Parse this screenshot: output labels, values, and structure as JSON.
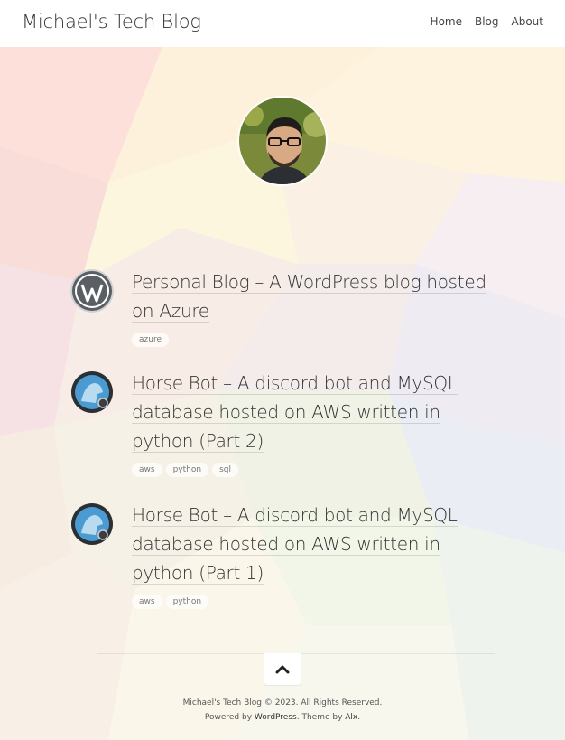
{
  "header": {
    "site_title": "Michael's Tech Blog",
    "nav": [
      "Home",
      "Blog",
      "About"
    ]
  },
  "posts": [
    {
      "title_line1": "Personal Blog – A WordPress blog hosted",
      "title_line2": "on Azure",
      "icon": "wordpress-logo-icon",
      "tags": [
        "azure"
      ]
    },
    {
      "title_line1": "Horse Bot – A discord bot and MySQL",
      "title_line2": "database hosted on AWS written in",
      "title_line3": "python (Part 2)",
      "icon": "discord-bot-icon",
      "tags": [
        "aws",
        "python",
        "sql"
      ]
    },
    {
      "title_line1": "Horse Bot – A discord bot and MySQL",
      "title_line2": "database hosted on AWS written in",
      "title_line3": "python (Part 1)",
      "icon": "discord-bot-icon",
      "tags": [
        "aws",
        "python"
      ]
    }
  ],
  "footer": {
    "copyright": "Michael's Tech Blog © 2023. All Rights Reserved.",
    "powered_prefix": "Powered by ",
    "powered_link": "WordPress",
    "theme_prefix": ". Theme by ",
    "theme_link": "Alx",
    "theme_suffix": "."
  },
  "colors": {
    "header_bg": "#ffffff",
    "text": "#333333",
    "tag_bg": "#ffffff"
  }
}
